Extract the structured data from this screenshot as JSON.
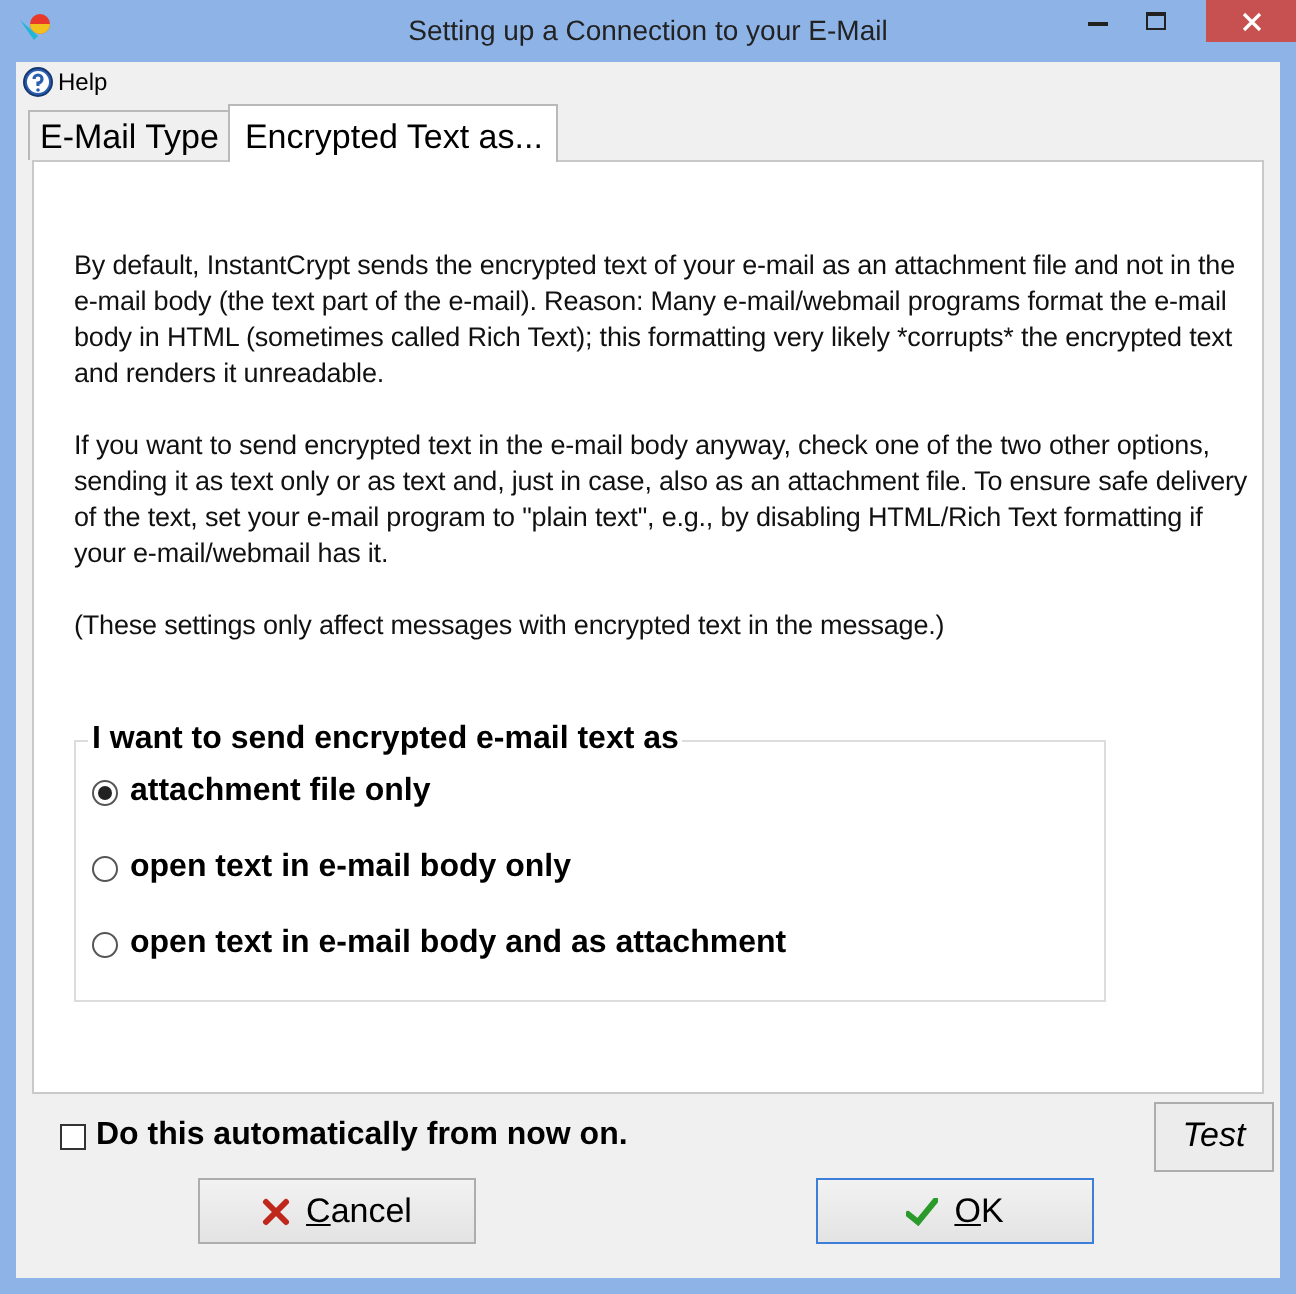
{
  "window": {
    "title": "Setting up a Connection to your E-Mail"
  },
  "menu": [
    {
      "label": "Help"
    }
  ],
  "tabs": [
    {
      "label": "E-Mail Type",
      "selected": false
    },
    {
      "label": "Encrypted Text as...",
      "selected": true
    }
  ],
  "paragraphs": [
    "By default, InstantCrypt sends the encrypted text of your e-mail as an attachment file and not in the e-mail body (the text part of the e-mail). Reason: Many e-mail/webmail programs format the e-mail body in HTML (sometimes called Rich Text); this formatting very likely *corrupts* the encrypted text and renders it unreadable.",
    "If you want to send encrypted text in the e-mail body anyway, check one of the two other options, sending it as text only or as text and, just in case, also as an attachment file. To ensure safe delivery of the text, set your e-mail program to \"plain text\", e.g., by disabling HTML/Rich Text formatting if your e-mail/webmail has it.",
    "(These settings only affect messages with encrypted text in the message.)"
  ],
  "group": {
    "title": "I want to send encrypted e-mail text as",
    "options": [
      {
        "label": "attachment file only",
        "selected": true
      },
      {
        "label": "open text in e-mail body only",
        "selected": false
      },
      {
        "label": "open text in e-mail body and as attachment",
        "selected": false
      }
    ]
  },
  "auto_checkbox": {
    "label": "Do this automatically from now on.",
    "checked": false
  },
  "buttons": [
    {
      "kind": "test",
      "label": "Test"
    },
    {
      "kind": "cancel",
      "label": "Cancel"
    },
    {
      "kind": "ok",
      "label": "OK"
    }
  ]
}
